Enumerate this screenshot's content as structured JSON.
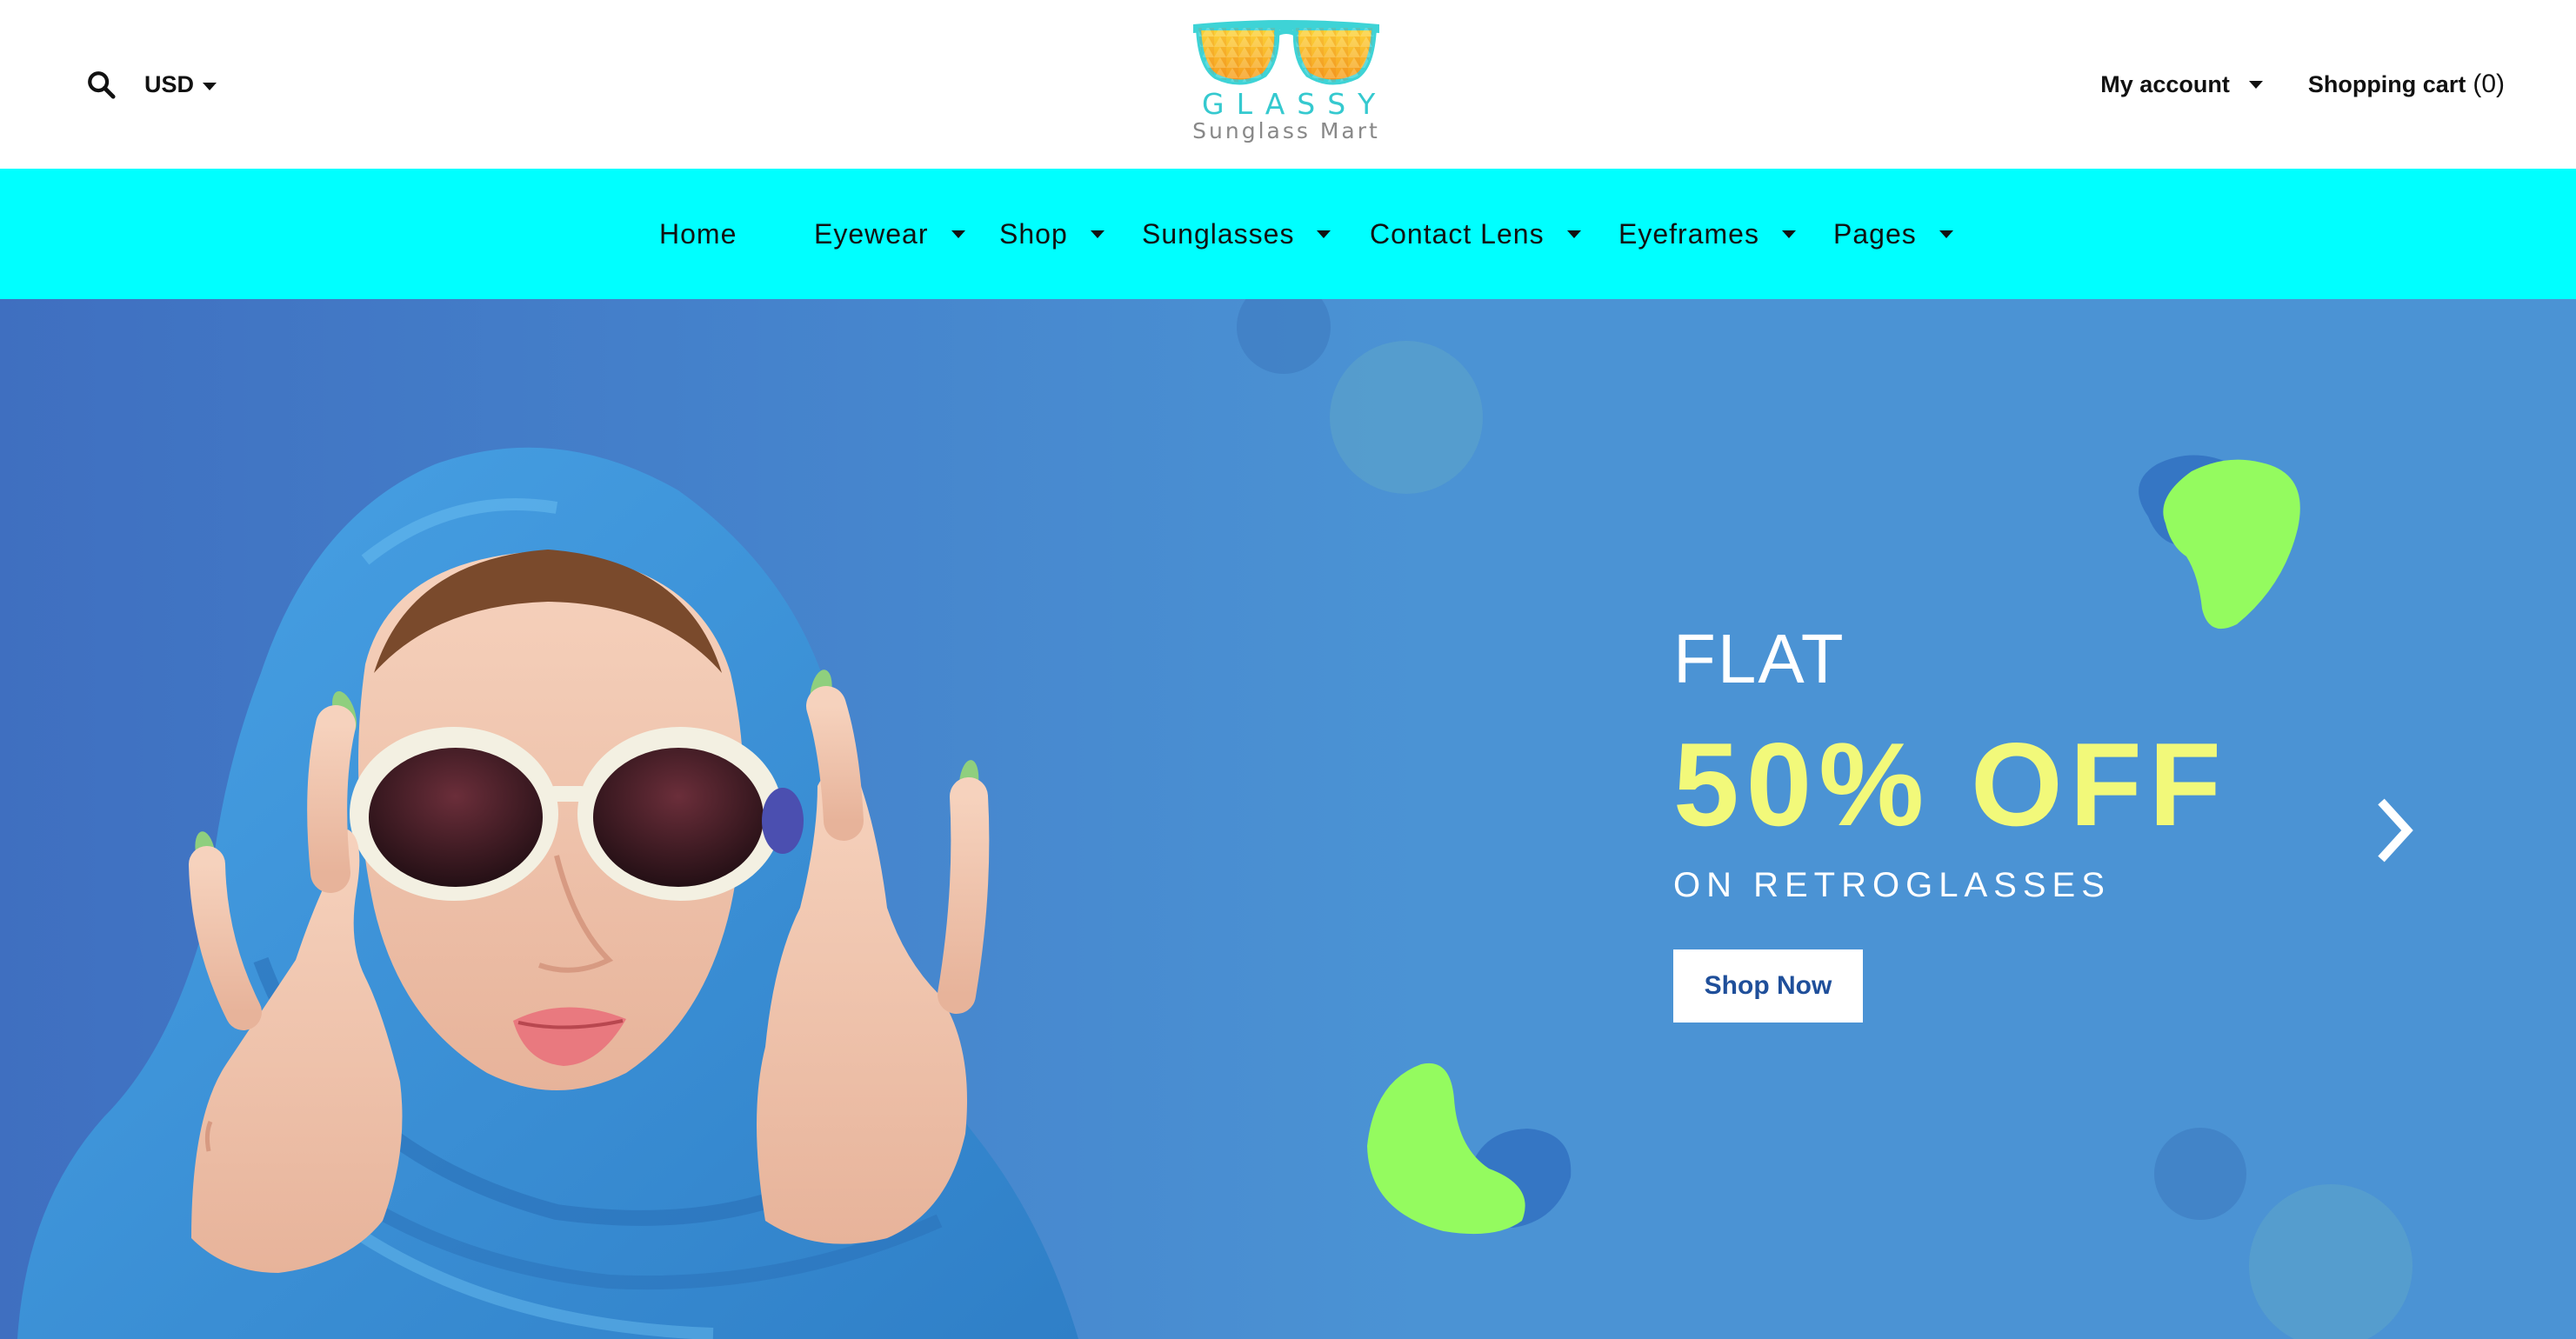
{
  "header": {
    "currency": "USD",
    "logo": {
      "word": "GLASSY",
      "tagline": "Sunglass Mart"
    },
    "account_label": "My account",
    "cart_label": "Shopping cart",
    "cart_count": "(0)"
  },
  "nav": {
    "items": [
      {
        "label": "Home",
        "has_dropdown": false
      },
      {
        "label": "Eyewear",
        "has_dropdown": true
      },
      {
        "label": "Shop",
        "has_dropdown": true
      },
      {
        "label": "Sunglasses",
        "has_dropdown": true
      },
      {
        "label": "Contact Lens",
        "has_dropdown": true
      },
      {
        "label": "Eyeframes",
        "has_dropdown": true
      },
      {
        "label": "Pages",
        "has_dropdown": true
      }
    ]
  },
  "hero": {
    "line1": "FLAT",
    "headline": "50% OFF",
    "subline": "ON RETROGLASSES",
    "cta": "Shop Now",
    "next_icon": "chevron-right-icon"
  },
  "colors": {
    "nav_background": "#00ffff",
    "hero_background": "#4b93d4",
    "headline": "#f2f97a",
    "blob_green": "#94fb5f",
    "cta_text": "#1f4f9a"
  }
}
